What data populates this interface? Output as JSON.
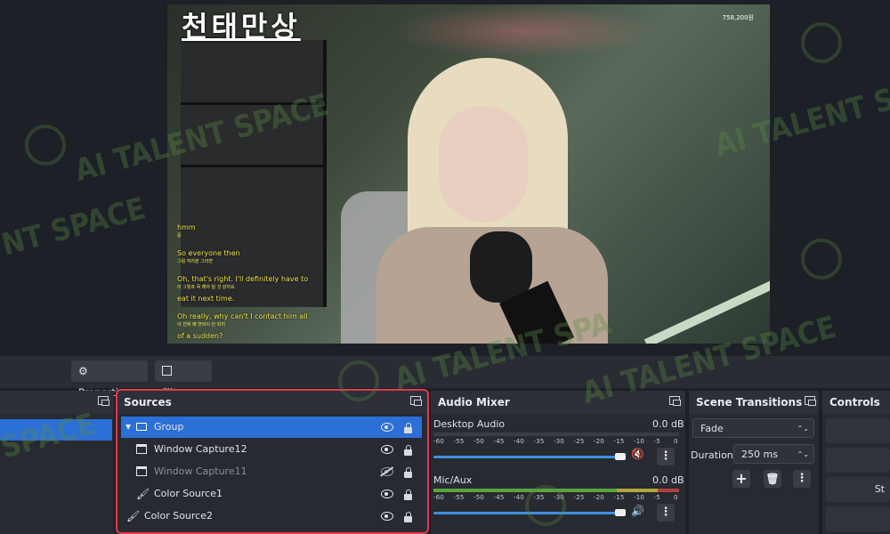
{
  "preview": {
    "stream_title": "천태만상",
    "viewer_count": "758,200원",
    "subtitles": [
      {
        "en": "hmm",
        "ko": "응"
      },
      {
        "en": "So everyone then",
        "ko": "그럼 여러분 그러면"
      },
      {
        "en": "Oh, that's right. I'll definitely have to",
        "ko": "아 그렇죠 꼭 해야 될 것 같아요"
      },
      {
        "en": "eat it next time.",
        "ko": ""
      },
      {
        "en": "Oh really, why can't I contact him all",
        "ko": "아 진짜 왜 연락이 안 되지"
      },
      {
        "en": "of a sudden?",
        "ko": ""
      }
    ]
  },
  "watermark": {
    "text_a": "AI TALENT SPACE",
    "text_b": "AI TALENT SP",
    "text_c": "NT SPACE",
    "text_d": "AI TALENT SPA",
    "text_e": "AI TALENT SPACE",
    "text_f": "SPACE"
  },
  "toolbar": {
    "properties_label": "Properties",
    "filters_label": "Filters"
  },
  "sources": {
    "title": "Sources",
    "items": [
      {
        "label": "Group",
        "type": "group",
        "visible": true,
        "locked": true,
        "selected": true
      },
      {
        "label": "Window Capture12",
        "type": "window",
        "visible": true,
        "locked": true
      },
      {
        "label": "Window Capture11",
        "type": "window",
        "visible": false,
        "locked": true
      },
      {
        "label": "Color Source1",
        "type": "color",
        "visible": true,
        "locked": true
      },
      {
        "label": "Color Source2",
        "type": "color",
        "visible": true,
        "locked": true
      }
    ]
  },
  "audio_mixer": {
    "title": "Audio Mixer",
    "scale_labels": [
      "-60",
      "-55",
      "-50",
      "-45",
      "-40",
      "-35",
      "-30",
      "-25",
      "-20",
      "-15",
      "-10",
      "-5",
      "0"
    ],
    "channels": [
      {
        "name": "Desktop Audio",
        "level": "0.0 dB",
        "muted": true
      },
      {
        "name": "Mic/Aux",
        "level": "0.0 dB",
        "muted": false
      }
    ]
  },
  "scene_transitions": {
    "title": "Scene Transitions",
    "selected": "Fade",
    "duration_label": "Duration",
    "duration_value": "250 ms"
  },
  "controls": {
    "title": "Controls",
    "partial_label": "St"
  },
  "colors": {
    "accent": "#2c6fd6",
    "highlight_border": "#e03a4a",
    "dock_bg": "#272a31"
  }
}
